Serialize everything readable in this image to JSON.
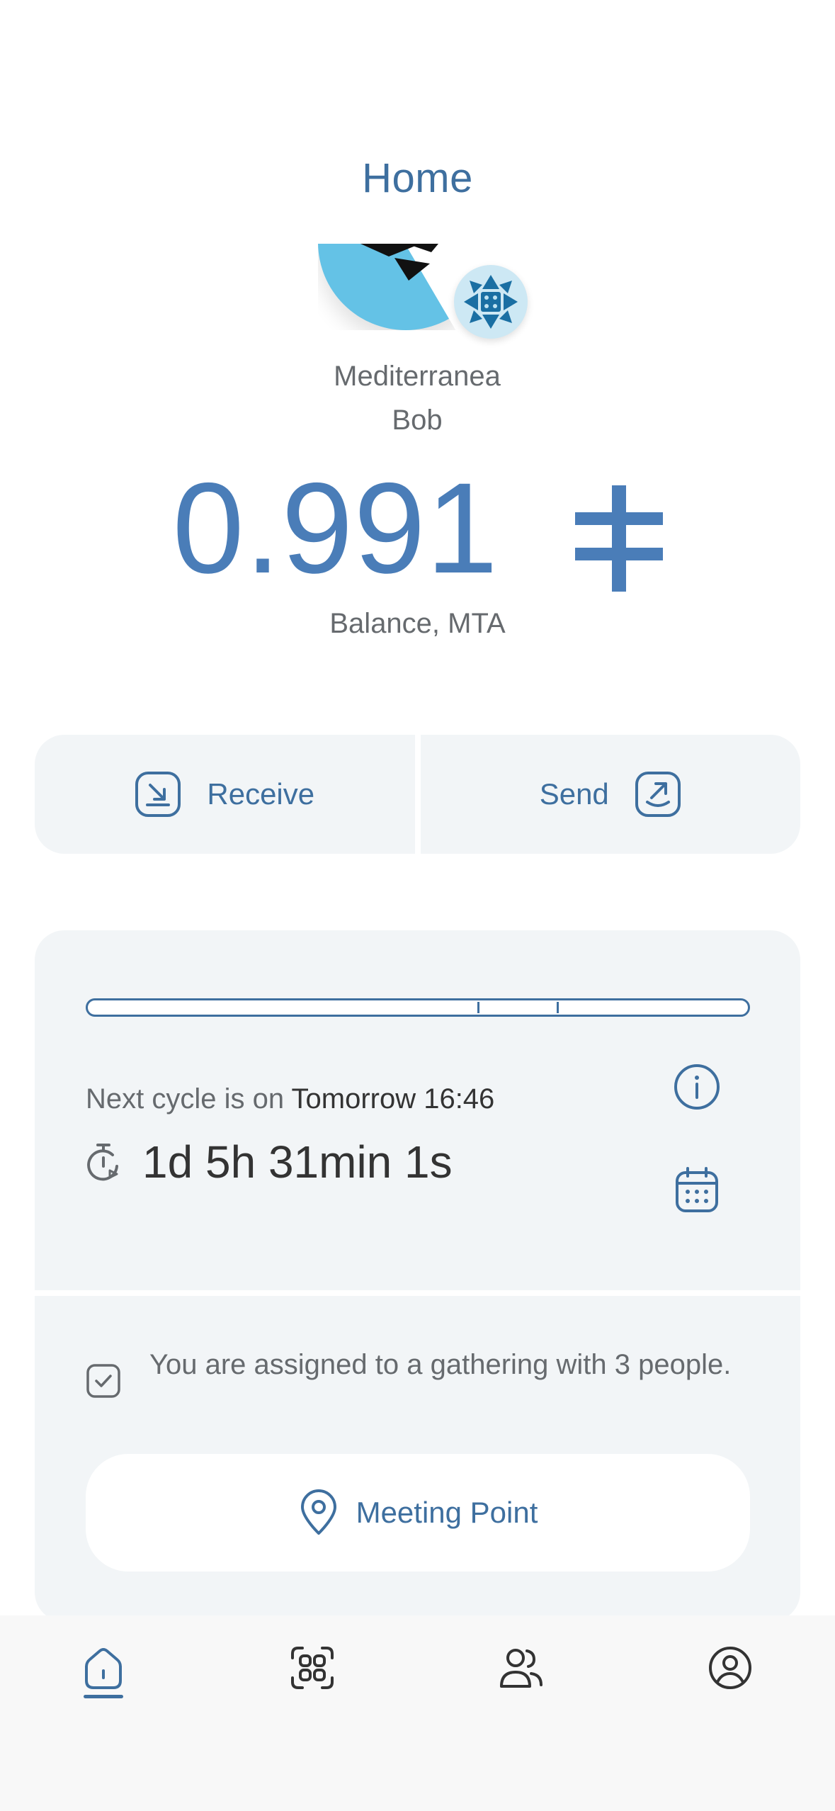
{
  "header": {
    "title": "Home"
  },
  "profile": {
    "name_line1": "Mediterranea",
    "name_line2": "Bob",
    "avatar_icon": "community-avatar",
    "badge_icon": "community-badge-icon"
  },
  "balance": {
    "amount": "0.991",
    "currency_symbol": "ᵽ",
    "label": "Balance, MTA"
  },
  "actions": {
    "receive_label": "Receive",
    "send_label": "Send"
  },
  "cycle": {
    "progress_marker_positions": [
      0.59,
      0.71
    ],
    "next_cycle_prefix": "Next cycle is on",
    "next_cycle_time": "Tomorrow 16:46",
    "countdown": "1d 5h 31min 1s"
  },
  "gathering": {
    "message": "You are assigned to a gathering with 3 people.",
    "meeting_point_label": "Meeting Point"
  },
  "tabs": [
    {
      "name": "home",
      "icon": "home-icon",
      "active": true
    },
    {
      "name": "scan",
      "icon": "qr-scan-icon",
      "active": false
    },
    {
      "name": "contacts",
      "icon": "contacts-icon",
      "active": false
    },
    {
      "name": "profile",
      "icon": "profile-icon",
      "active": false
    }
  ],
  "colors": {
    "accent": "#3e6f9f",
    "balance": "#4a7db8",
    "card_bg": "#f2f5f7",
    "avatar_blue": "#64c2e6"
  }
}
